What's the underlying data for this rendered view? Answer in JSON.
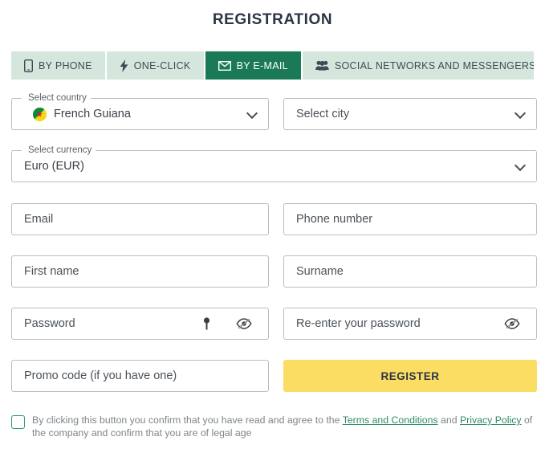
{
  "page": {
    "title": "REGISTRATION",
    "accent_green": "#1a7a56",
    "tab_bg": "#d5e7dd",
    "register_yellow": "#fbdd63",
    "link_green": "#2e8b63"
  },
  "tabs": [
    {
      "label": "BY PHONE",
      "icon": "mobile-phone-icon",
      "active": false
    },
    {
      "label": "ONE-CLICK",
      "icon": "lightning-bolt-icon",
      "active": false
    },
    {
      "label": "BY E-MAIL",
      "icon": "envelope-icon",
      "active": true
    },
    {
      "label": "SOCIAL NETWORKS AND MESSENGERS",
      "icon": "people-group-icon",
      "active": false
    }
  ],
  "form": {
    "country": {
      "label": "Select country",
      "value": "French Guiana",
      "flag": "french-guiana-flag-icon"
    },
    "city": {
      "placeholder": "Select city"
    },
    "currency": {
      "label": "Select currency",
      "value": "Euro (EUR)"
    },
    "email": {
      "placeholder": "Email",
      "value": ""
    },
    "phone": {
      "placeholder": "Phone number",
      "value": ""
    },
    "first_name": {
      "placeholder": "First name",
      "value": ""
    },
    "surname": {
      "placeholder": "Surname",
      "value": ""
    },
    "password": {
      "placeholder": "Password",
      "value": "",
      "key_icon": "key-icon",
      "eye_icon": "eye-off-icon"
    },
    "password_confirm": {
      "placeholder": "Re-enter your password",
      "value": "",
      "eye_icon": "eye-off-icon"
    },
    "promo": {
      "placeholder": "Promo code (if you have one)",
      "value": ""
    },
    "register_button": "REGISTER"
  },
  "consent": {
    "checked": false,
    "text_before": "By clicking this button you confirm that you have read and agree to the ",
    "link_terms": "Terms and Conditions",
    "text_between": " and ",
    "link_privacy": "Privacy Policy",
    "text_after": " of the company and confirm that you are of legal age"
  }
}
